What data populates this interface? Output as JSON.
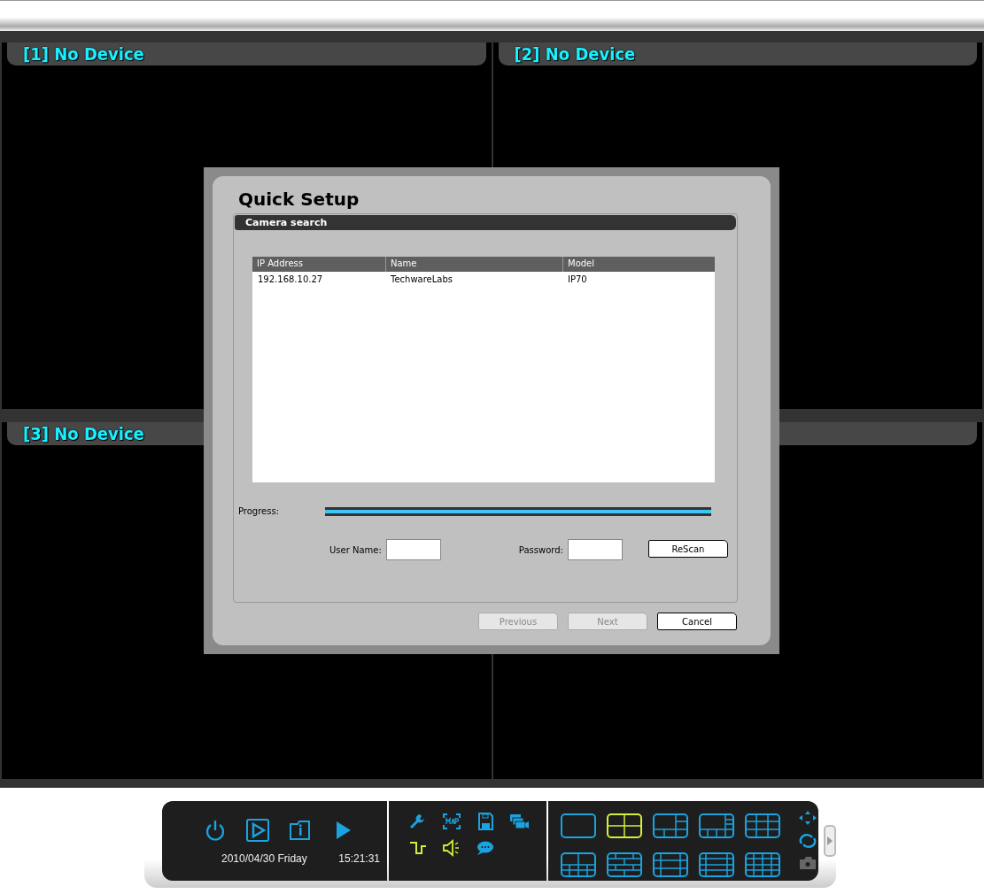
{
  "panes": [
    {
      "label": "[1] No Device"
    },
    {
      "label": "[2] No Device"
    },
    {
      "label": "[3] No Device"
    }
  ],
  "dialog": {
    "title": "Quick Setup",
    "section": "Camera search",
    "table": {
      "columns": [
        "IP Address",
        "Name",
        "Model"
      ],
      "rows": [
        [
          "192.168.10.27",
          "TechwareLabs",
          "IP70"
        ]
      ]
    },
    "progress": {
      "label": "Progress:",
      "level": 1
    },
    "user_name": {
      "label": "User Name:"
    },
    "password": {
      "label": "Password:"
    },
    "rescan": "ReScan",
    "buttons": [
      {
        "label": "Previous",
        "disabled": true
      },
      {
        "label": "Next",
        "disabled": true
      },
      {
        "label": "Cancel",
        "disabled": false
      }
    ]
  },
  "toolbar": {
    "date": "2010/04/30 Friday",
    "time": "15:21:31",
    "tools": [
      {
        "kind": "wrench",
        "on": false
      },
      {
        "kind": "map",
        "on": false
      },
      {
        "kind": "disk",
        "on": false
      },
      {
        "kind": "cameras",
        "on": false
      },
      {
        "kind": "signal",
        "on": true
      },
      {
        "kind": "speaker",
        "on": true
      },
      {
        "kind": "chat",
        "on": false
      }
    ],
    "layouts": [
      {
        "selected": false
      },
      {
        "selected": true
      },
      {
        "selected": false
      },
      {
        "selected": false
      },
      {
        "selected": false
      },
      {
        "selected": false
      },
      {
        "selected": false
      },
      {
        "selected": false
      },
      {
        "selected": false
      },
      {
        "selected": false
      }
    ]
  }
}
